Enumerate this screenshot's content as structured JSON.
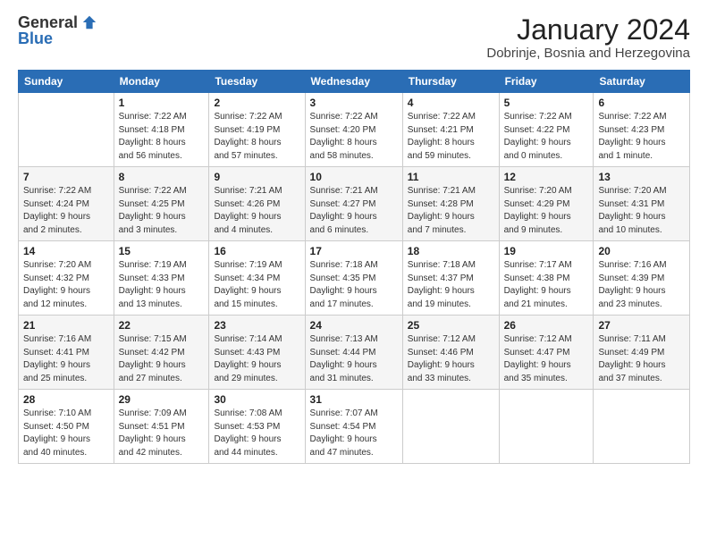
{
  "logo": {
    "general": "General",
    "blue": "Blue"
  },
  "header": {
    "title": "January 2024",
    "subtitle": "Dobrinje, Bosnia and Herzegovina"
  },
  "weekdays": [
    "Sunday",
    "Monday",
    "Tuesday",
    "Wednesday",
    "Thursday",
    "Friday",
    "Saturday"
  ],
  "weeks": [
    [
      {
        "day": "",
        "info": ""
      },
      {
        "day": "1",
        "info": "Sunrise: 7:22 AM\nSunset: 4:18 PM\nDaylight: 8 hours\nand 56 minutes."
      },
      {
        "day": "2",
        "info": "Sunrise: 7:22 AM\nSunset: 4:19 PM\nDaylight: 8 hours\nand 57 minutes."
      },
      {
        "day": "3",
        "info": "Sunrise: 7:22 AM\nSunset: 4:20 PM\nDaylight: 8 hours\nand 58 minutes."
      },
      {
        "day": "4",
        "info": "Sunrise: 7:22 AM\nSunset: 4:21 PM\nDaylight: 8 hours\nand 59 minutes."
      },
      {
        "day": "5",
        "info": "Sunrise: 7:22 AM\nSunset: 4:22 PM\nDaylight: 9 hours\nand 0 minutes."
      },
      {
        "day": "6",
        "info": "Sunrise: 7:22 AM\nSunset: 4:23 PM\nDaylight: 9 hours\nand 1 minute."
      }
    ],
    [
      {
        "day": "7",
        "info": "Sunrise: 7:22 AM\nSunset: 4:24 PM\nDaylight: 9 hours\nand 2 minutes."
      },
      {
        "day": "8",
        "info": "Sunrise: 7:22 AM\nSunset: 4:25 PM\nDaylight: 9 hours\nand 3 minutes."
      },
      {
        "day": "9",
        "info": "Sunrise: 7:21 AM\nSunset: 4:26 PM\nDaylight: 9 hours\nand 4 minutes."
      },
      {
        "day": "10",
        "info": "Sunrise: 7:21 AM\nSunset: 4:27 PM\nDaylight: 9 hours\nand 6 minutes."
      },
      {
        "day": "11",
        "info": "Sunrise: 7:21 AM\nSunset: 4:28 PM\nDaylight: 9 hours\nand 7 minutes."
      },
      {
        "day": "12",
        "info": "Sunrise: 7:20 AM\nSunset: 4:29 PM\nDaylight: 9 hours\nand 9 minutes."
      },
      {
        "day": "13",
        "info": "Sunrise: 7:20 AM\nSunset: 4:31 PM\nDaylight: 9 hours\nand 10 minutes."
      }
    ],
    [
      {
        "day": "14",
        "info": "Sunrise: 7:20 AM\nSunset: 4:32 PM\nDaylight: 9 hours\nand 12 minutes."
      },
      {
        "day": "15",
        "info": "Sunrise: 7:19 AM\nSunset: 4:33 PM\nDaylight: 9 hours\nand 13 minutes."
      },
      {
        "day": "16",
        "info": "Sunrise: 7:19 AM\nSunset: 4:34 PM\nDaylight: 9 hours\nand 15 minutes."
      },
      {
        "day": "17",
        "info": "Sunrise: 7:18 AM\nSunset: 4:35 PM\nDaylight: 9 hours\nand 17 minutes."
      },
      {
        "day": "18",
        "info": "Sunrise: 7:18 AM\nSunset: 4:37 PM\nDaylight: 9 hours\nand 19 minutes."
      },
      {
        "day": "19",
        "info": "Sunrise: 7:17 AM\nSunset: 4:38 PM\nDaylight: 9 hours\nand 21 minutes."
      },
      {
        "day": "20",
        "info": "Sunrise: 7:16 AM\nSunset: 4:39 PM\nDaylight: 9 hours\nand 23 minutes."
      }
    ],
    [
      {
        "day": "21",
        "info": "Sunrise: 7:16 AM\nSunset: 4:41 PM\nDaylight: 9 hours\nand 25 minutes."
      },
      {
        "day": "22",
        "info": "Sunrise: 7:15 AM\nSunset: 4:42 PM\nDaylight: 9 hours\nand 27 minutes."
      },
      {
        "day": "23",
        "info": "Sunrise: 7:14 AM\nSunset: 4:43 PM\nDaylight: 9 hours\nand 29 minutes."
      },
      {
        "day": "24",
        "info": "Sunrise: 7:13 AM\nSunset: 4:44 PM\nDaylight: 9 hours\nand 31 minutes."
      },
      {
        "day": "25",
        "info": "Sunrise: 7:12 AM\nSunset: 4:46 PM\nDaylight: 9 hours\nand 33 minutes."
      },
      {
        "day": "26",
        "info": "Sunrise: 7:12 AM\nSunset: 4:47 PM\nDaylight: 9 hours\nand 35 minutes."
      },
      {
        "day": "27",
        "info": "Sunrise: 7:11 AM\nSunset: 4:49 PM\nDaylight: 9 hours\nand 37 minutes."
      }
    ],
    [
      {
        "day": "28",
        "info": "Sunrise: 7:10 AM\nSunset: 4:50 PM\nDaylight: 9 hours\nand 40 minutes."
      },
      {
        "day": "29",
        "info": "Sunrise: 7:09 AM\nSunset: 4:51 PM\nDaylight: 9 hours\nand 42 minutes."
      },
      {
        "day": "30",
        "info": "Sunrise: 7:08 AM\nSunset: 4:53 PM\nDaylight: 9 hours\nand 44 minutes."
      },
      {
        "day": "31",
        "info": "Sunrise: 7:07 AM\nSunset: 4:54 PM\nDaylight: 9 hours\nand 47 minutes."
      },
      {
        "day": "",
        "info": ""
      },
      {
        "day": "",
        "info": ""
      },
      {
        "day": "",
        "info": ""
      }
    ]
  ]
}
